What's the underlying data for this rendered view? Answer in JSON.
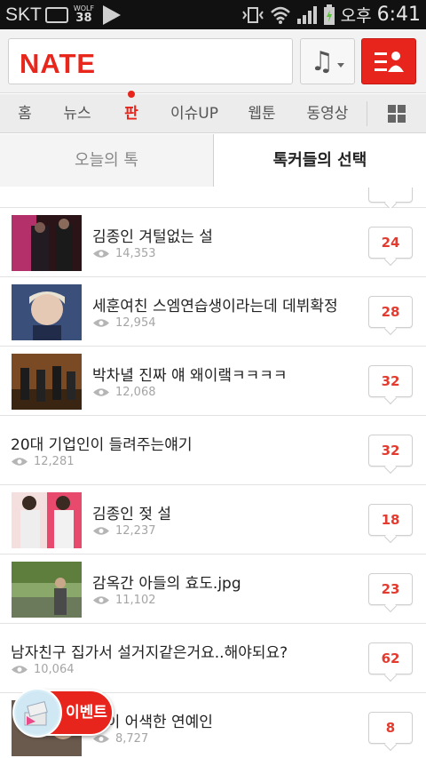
{
  "status_bar": {
    "carrier": "SKT",
    "badge_top": "WOLF",
    "badge_num": "38",
    "ampm": "오후",
    "time": "6:41"
  },
  "header": {
    "logo": "NATE",
    "music_icon": "music-note-icon",
    "profile_icon": "profile-list-icon"
  },
  "nav": {
    "items": [
      {
        "label": "홈"
      },
      {
        "label": "뉴스"
      },
      {
        "label": "판"
      },
      {
        "label": "이슈UP"
      },
      {
        "label": "웹툰"
      },
      {
        "label": "동영상"
      }
    ],
    "active": "판"
  },
  "tabs": {
    "left": "오늘의 톡",
    "right": "톡커들의 선택",
    "active": "right"
  },
  "posts": [
    {
      "title": "김종인 겨털없는 설",
      "views": "14,353",
      "comments": "24"
    },
    {
      "title": "세훈여친 스엠연습생이라는데 데뷔확정",
      "views": "12,954",
      "comments": "28"
    },
    {
      "title": "박차녈 진짜 얘 왜이랰ㅋㅋㅋㅋ",
      "views": "12,068",
      "comments": "32"
    },
    {
      "title": "20대 기업인이 들려주는얘기",
      "views": "12,281",
      "comments": "32"
    },
    {
      "title": "김종인 젖 설",
      "views": "12,237",
      "comments": "18"
    },
    {
      "title": "감옥간 아들의 효도.jpg",
      "views": "11,102",
      "comments": "23"
    },
    {
      "title": "남자친구 집가서 설거지같은거요..해야되요?",
      "views": "10,064",
      "comments": "62"
    },
    {
      "title": "경이 어색한 연예인",
      "views": "8,727",
      "comments": "8"
    }
  ],
  "event_button": {
    "label": "이벤트"
  },
  "colors": {
    "brand": "#e8251c",
    "comment": "#e33b2f"
  }
}
